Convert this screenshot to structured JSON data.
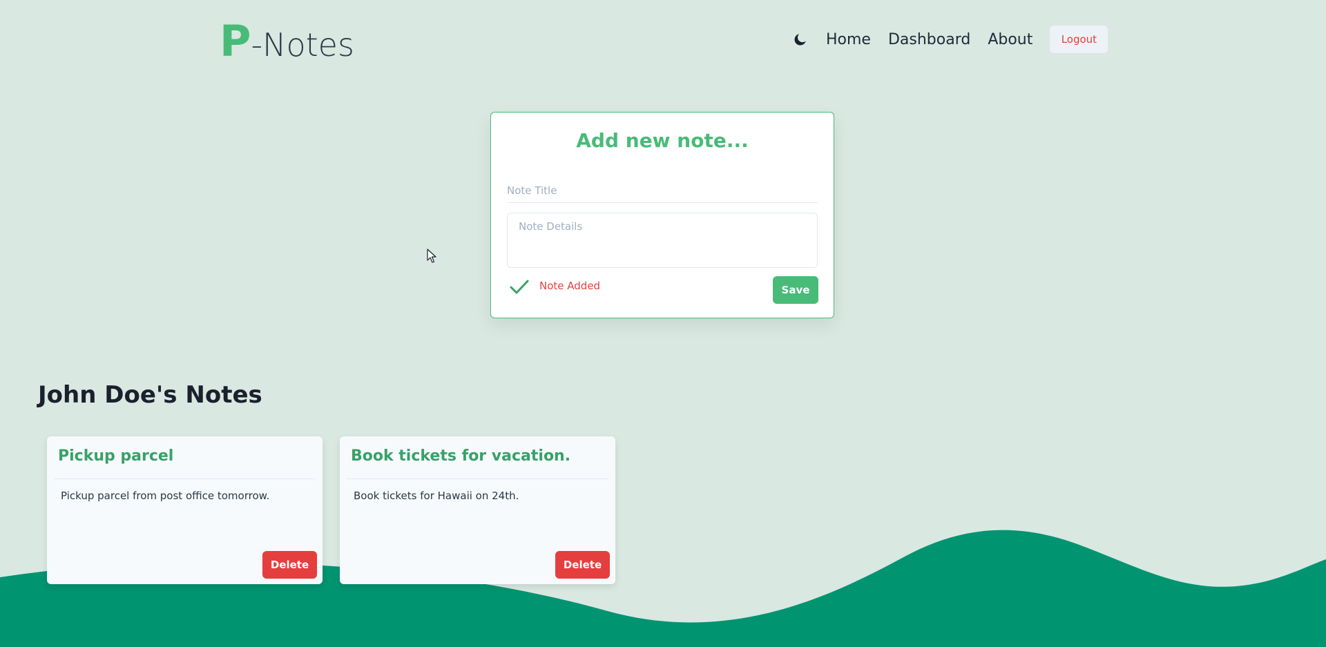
{
  "app": {
    "logo_initial": "P",
    "logo_rest": "-Notes"
  },
  "nav": {
    "theme_icon": "moon-icon",
    "links": [
      "Home",
      "Dashboard",
      "About"
    ],
    "logout_label": "Logout"
  },
  "add_note": {
    "heading": "Add new note...",
    "title_placeholder": "Note Title",
    "details_placeholder": "Note Details",
    "status_icon": "check-icon",
    "status_text": "Note Added",
    "save_label": "Save"
  },
  "notes_section": {
    "heading": "John Doe's Notes",
    "notes": [
      {
        "title": "Pickup parcel",
        "body": "Pickup parcel from post office tomorrow.",
        "delete_label": "Delete"
      },
      {
        "title": "Book tickets for vacation.",
        "body": "Book tickets for Hawaii on 24th.",
        "delete_label": "Delete"
      }
    ]
  },
  "colors": {
    "background": "#d9e8e1",
    "accent_green": "#48bb78",
    "wave": "#009471",
    "danger": "#e53e3e"
  }
}
